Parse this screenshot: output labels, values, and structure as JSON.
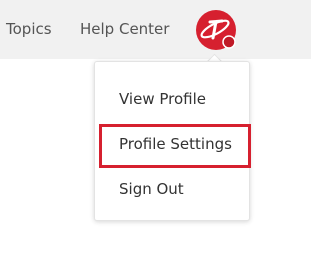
{
  "topbar": {
    "links": [
      "Topics",
      "Help Center"
    ],
    "avatar_icon": "trend-micro-logo-icon",
    "brand_color": "#d6202f"
  },
  "profile_menu": {
    "items": [
      "View Profile",
      "Profile Settings",
      "Sign Out"
    ],
    "highlighted_item": "Profile Settings",
    "highlight_color": "#d6202f"
  }
}
